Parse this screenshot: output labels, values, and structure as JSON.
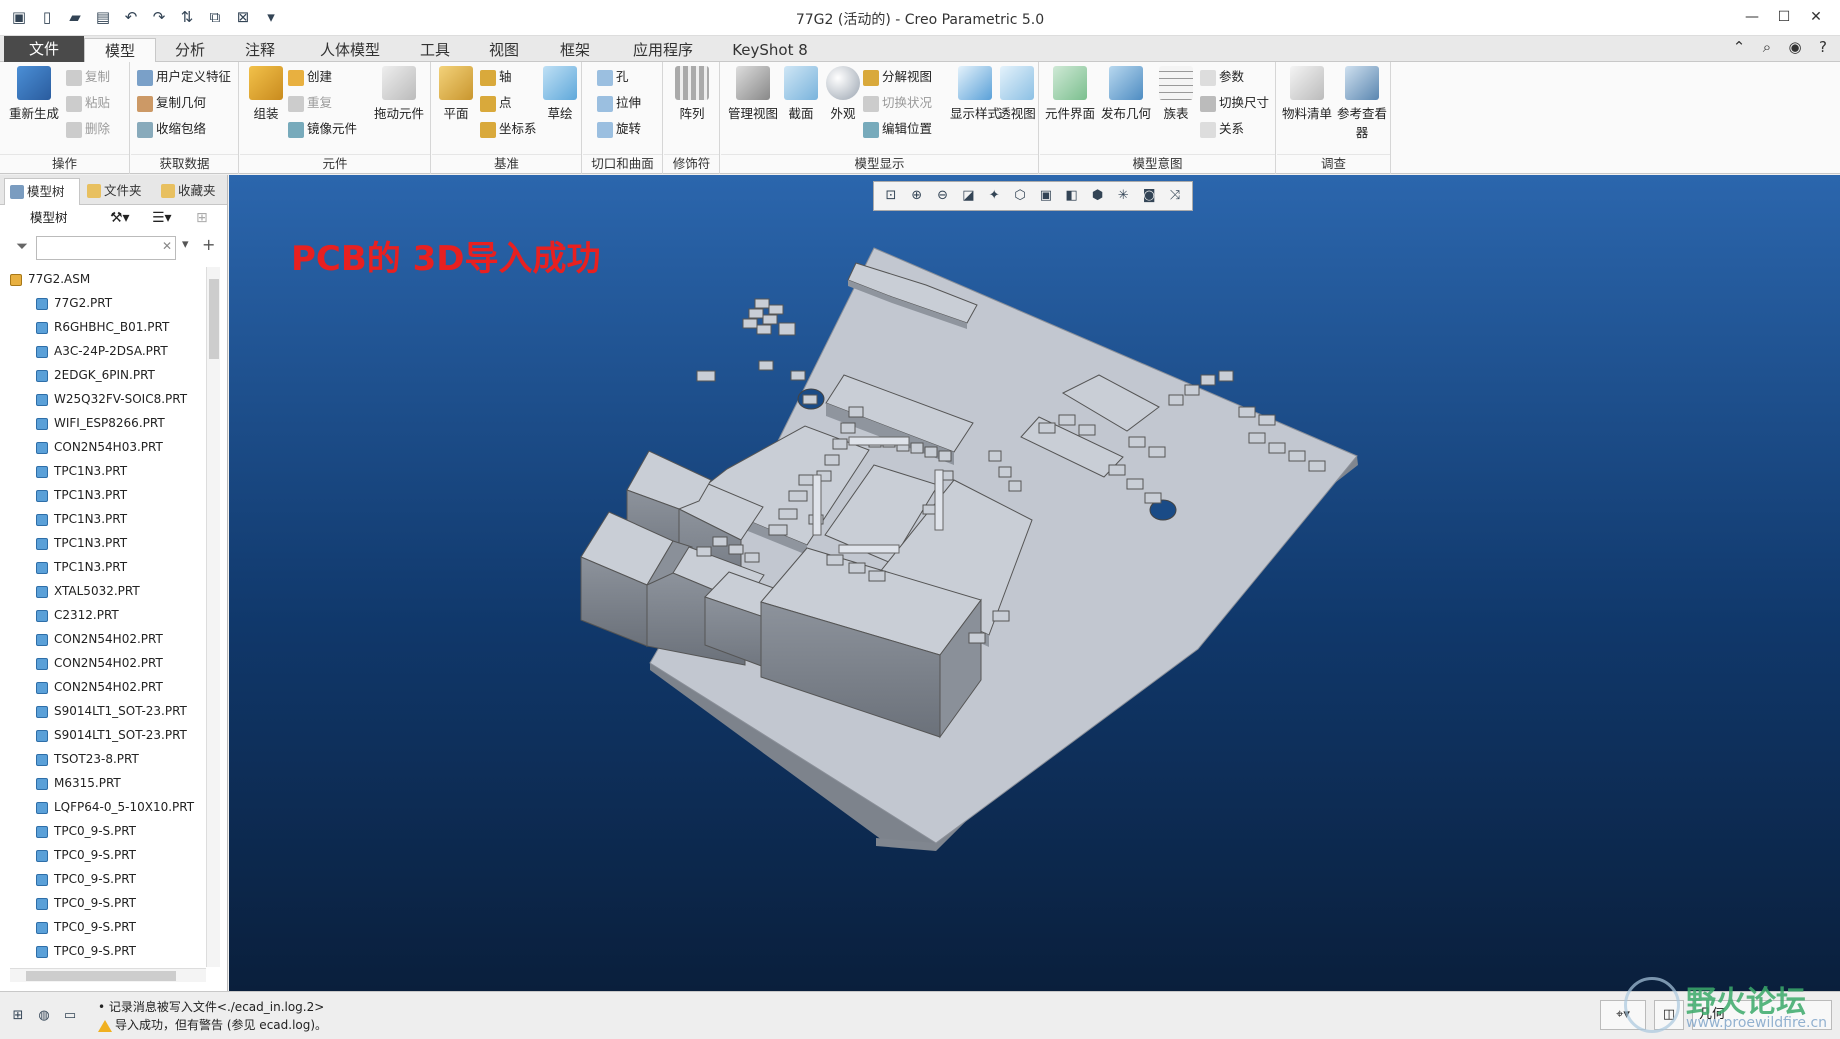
{
  "window": {
    "title": "77G2 (活动的) - Creo Parametric 5.0"
  },
  "tabs": [
    "文件",
    "模型",
    "分析",
    "注释",
    "人体模型",
    "工具",
    "视图",
    "框架",
    "应用程序",
    "KeyShot 8"
  ],
  "ribbon": {
    "ops": {
      "label": "操作",
      "regen": "重新生成",
      "copy": "复制",
      "paste": "粘贴",
      "delete": "删除"
    },
    "getdata": {
      "label": "获取数据",
      "udf": "用户定义特征",
      "copygeom": "复制几何",
      "shrink": "收缩包络"
    },
    "component": {
      "label": "元件",
      "assemble": "组装",
      "create": "创建",
      "repeat": "重复",
      "mirror": "镜像元件",
      "drag": "拖动元件"
    },
    "datum": {
      "label": "基准",
      "plane": "平面",
      "axis": "轴",
      "point": "点",
      "csys": "坐标系",
      "sketch": "草绘"
    },
    "cut": {
      "label": "切口和曲面",
      "hole": "孔",
      "extrude": "拉伸",
      "revolve": "旋转"
    },
    "mod": {
      "label": "修饰符",
      "pattern": "阵列"
    },
    "display": {
      "label": "模型显示",
      "manage": "管理视图",
      "section": "截面",
      "appearance": "外观",
      "explode": "分解视图",
      "toggle": "切换状况",
      "editpos": "编辑位置",
      "style": "显示样式",
      "perspective": "透视图"
    },
    "intent": {
      "label": "模型意图",
      "compif": "元件界面",
      "pubgeom": "发布几何",
      "family": "族表",
      "params": "参数",
      "switchdim": "切换尺寸",
      "relations": "关系"
    },
    "investigate": {
      "label": "调查",
      "bom": "物料清单",
      "refviewer": "参考查看器"
    }
  },
  "panel": {
    "tabs": [
      "模型树",
      "文件夹",
      "收藏夹"
    ],
    "tree_label": "模型树",
    "filter_placeholder": ""
  },
  "tree": [
    "77G2.ASM",
    "77G2.PRT",
    "R6GHBHC_B01.PRT",
    "A3C-24P-2DSA.PRT",
    "2EDGK_6PIN.PRT",
    "W25Q32FV-SOIC8.PRT",
    "WIFI_ESP8266.PRT",
    "CON2N54H03.PRT",
    "TPC1N3.PRT",
    "TPC1N3.PRT",
    "TPC1N3.PRT",
    "TPC1N3.PRT",
    "TPC1N3.PRT",
    "XTAL5032.PRT",
    "C2312.PRT",
    "CON2N54H02.PRT",
    "CON2N54H02.PRT",
    "CON2N54H02.PRT",
    "S9014LT1_SOT-23.PRT",
    "S9014LT1_SOT-23.PRT",
    "TSOT23-8.PRT",
    "M6315.PRT",
    "LQFP64-0_5-10X10.PRT",
    "TPC0_9-S.PRT",
    "TPC0_9-S.PRT",
    "TPC0_9-S.PRT",
    "TPC0_9-S.PRT",
    "TPC0_9-S.PRT",
    "TPC0_9-S.PRT"
  ],
  "viewport": {
    "message": "PCB的 3D导入成功"
  },
  "status": {
    "line1": "• 记录消息被写入文件<./ecad_in.log.2>",
    "line2": "导入成功，但有警告 (参见 ecad.log)。",
    "filter": "几何"
  },
  "watermark": {
    "text": "野火论坛",
    "url": "www.proewildfire.cn"
  },
  "colors": {
    "viewport_top": "#2b66ad",
    "viewport_bottom": "#0a1f3c",
    "pcb_top": "#c2c7d0",
    "message": "#e82020"
  }
}
